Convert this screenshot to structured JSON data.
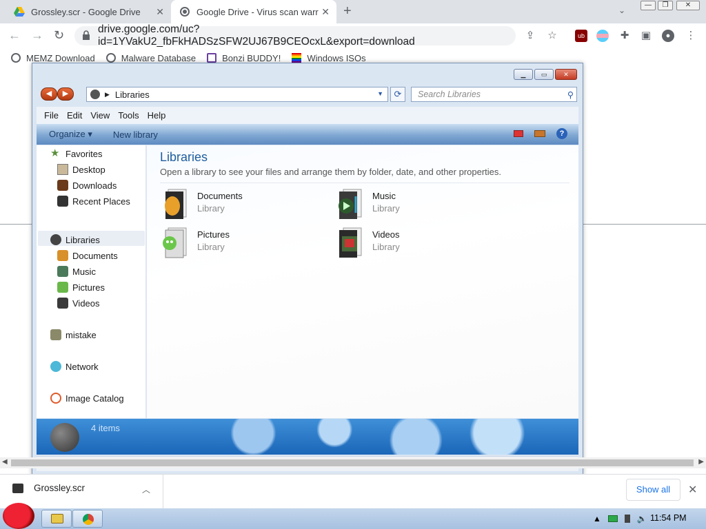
{
  "browser": {
    "tabs": [
      {
        "title": "Grossley.scr - Google Drive"
      },
      {
        "title": "Google Drive - Virus scan warr"
      }
    ],
    "url": "drive.google.com/uc?id=1YVakU2_fbFkHADSzSFW2UJ67B9CEOcxL&export=download",
    "bookmarks": [
      {
        "label": "MEMZ Download"
      },
      {
        "label": "Malware Database"
      },
      {
        "label": "Bonzi BUDDY!"
      },
      {
        "label": "Windows ISOs"
      }
    ]
  },
  "explorer": {
    "address": "Libraries",
    "search_placeholder": "Search Libraries",
    "menu": [
      "File",
      "Edit",
      "View",
      "Tools",
      "Help"
    ],
    "commands": {
      "organize": "Organize",
      "new_library": "New library"
    },
    "nav": {
      "favorites": "Favorites",
      "favorites_items": [
        "Desktop",
        "Downloads",
        "Recent Places"
      ],
      "libraries": "Libraries",
      "libraries_items": [
        "Documents",
        "Music",
        "Pictures",
        "Videos"
      ],
      "homegroup": "mistake",
      "network": "Network",
      "catalog": "Image Catalog"
    },
    "content": {
      "title": "Libraries",
      "subtitle": "Open a library to see your files and arrange them by folder, date, and other properties.",
      "libraries": [
        {
          "name": "Documents",
          "type": "Library"
        },
        {
          "name": "Music",
          "type": "Library"
        },
        {
          "name": "Pictures",
          "type": "Library"
        },
        {
          "name": "Videos",
          "type": "Library"
        }
      ]
    },
    "details": {
      "count": "4 items"
    }
  },
  "downloads": {
    "file": "Grossley.scr",
    "show_all": "Show all"
  },
  "taskbar": {
    "clock": "11:54 PM"
  },
  "colors": {
    "accent": "#1a73e8",
    "title_blue": "#1e5d9e",
    "taskbar": "#a7c1e0"
  }
}
